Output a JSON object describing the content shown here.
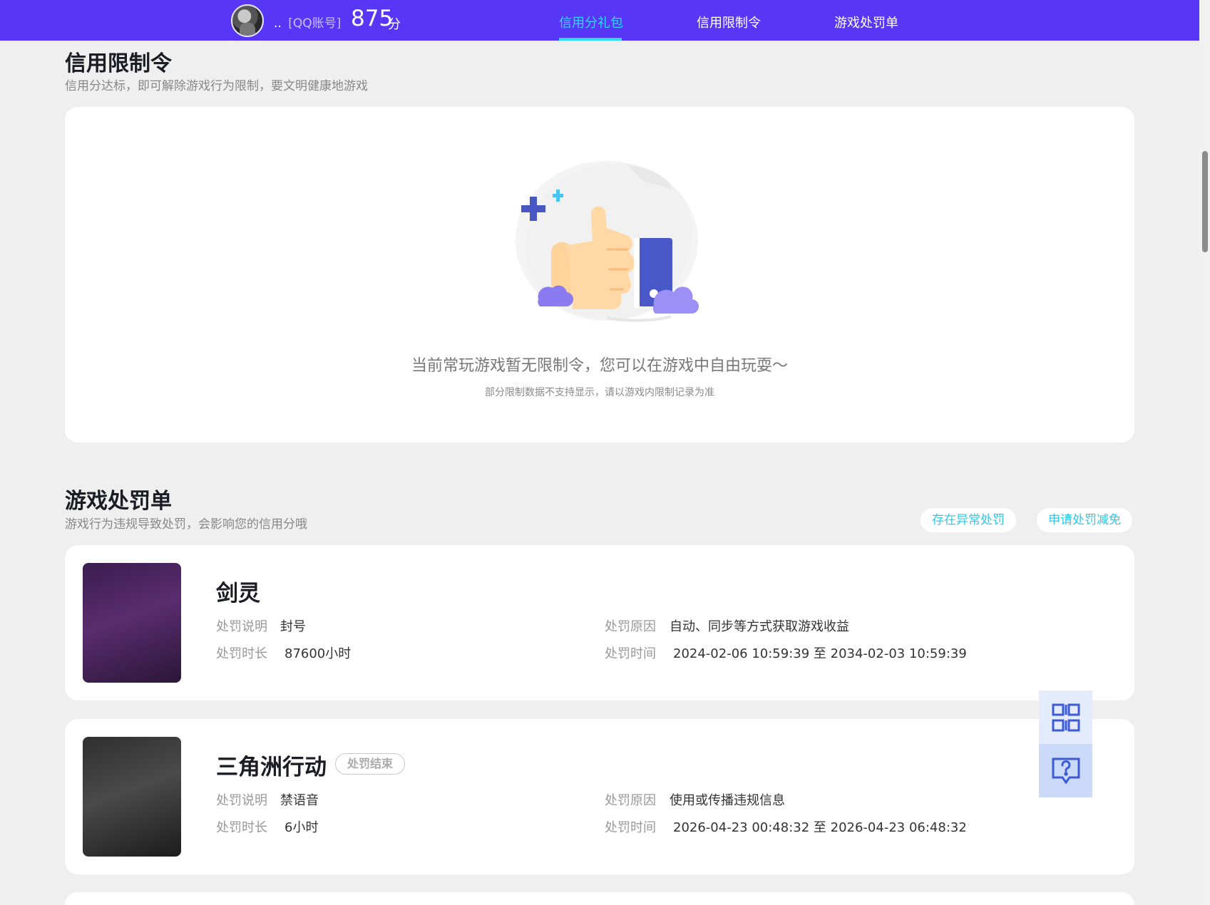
{
  "header": {
    "account_name": "..",
    "account_tag": "[QQ账号]",
    "score": "875",
    "score_unit": "分",
    "tabs": [
      {
        "label": "信用分礼包",
        "active": true
      },
      {
        "label": "信用限制令",
        "active": false
      },
      {
        "label": "游戏处罚单",
        "active": false
      }
    ]
  },
  "restriction": {
    "title": "信用限制令",
    "subtitle": "信用分达标，即可解除游戏行为限制，要文明健康地游戏",
    "empty_message": "当前常玩游戏暂无限制令，您可以在游戏中自由玩耍～",
    "empty_note": "部分限制数据不支持显示，请以游戏内限制记录为准"
  },
  "penalties": {
    "title": "游戏处罚单",
    "subtitle": "游戏行为违规导致处罚，会影响您的信用分哦",
    "btn_abnormal": "存在异常处罚",
    "btn_appeal": "申请处罚减免",
    "labels": {
      "desc": "处罚说明",
      "duration": "处罚时长",
      "reason": "处罚原因",
      "time": "处罚时间"
    },
    "items": [
      {
        "game": "剑灵",
        "badge": "",
        "desc": "封号",
        "duration": "87600小时",
        "reason": "自动、同步等方式获取游戏收益",
        "time": "2024-02-06 10:59:39 至 2034-02-03 10:59:39"
      },
      {
        "game": "三角洲行动",
        "badge": "处罚结束",
        "desc": "禁语音",
        "duration": "6小时",
        "reason": "使用或传播违规信息",
        "time": "2026-04-23 00:48:32 至 2026-04-23 06:48:32"
      }
    ]
  },
  "side_tools": {
    "qr_icon": "qr-code-icon",
    "help_icon": "help-chat-icon"
  },
  "colors": {
    "header_bg": "#5737f5",
    "accent": "#2fd8ff",
    "link": "#2ec7e8",
    "page_bg": "#efefef"
  }
}
